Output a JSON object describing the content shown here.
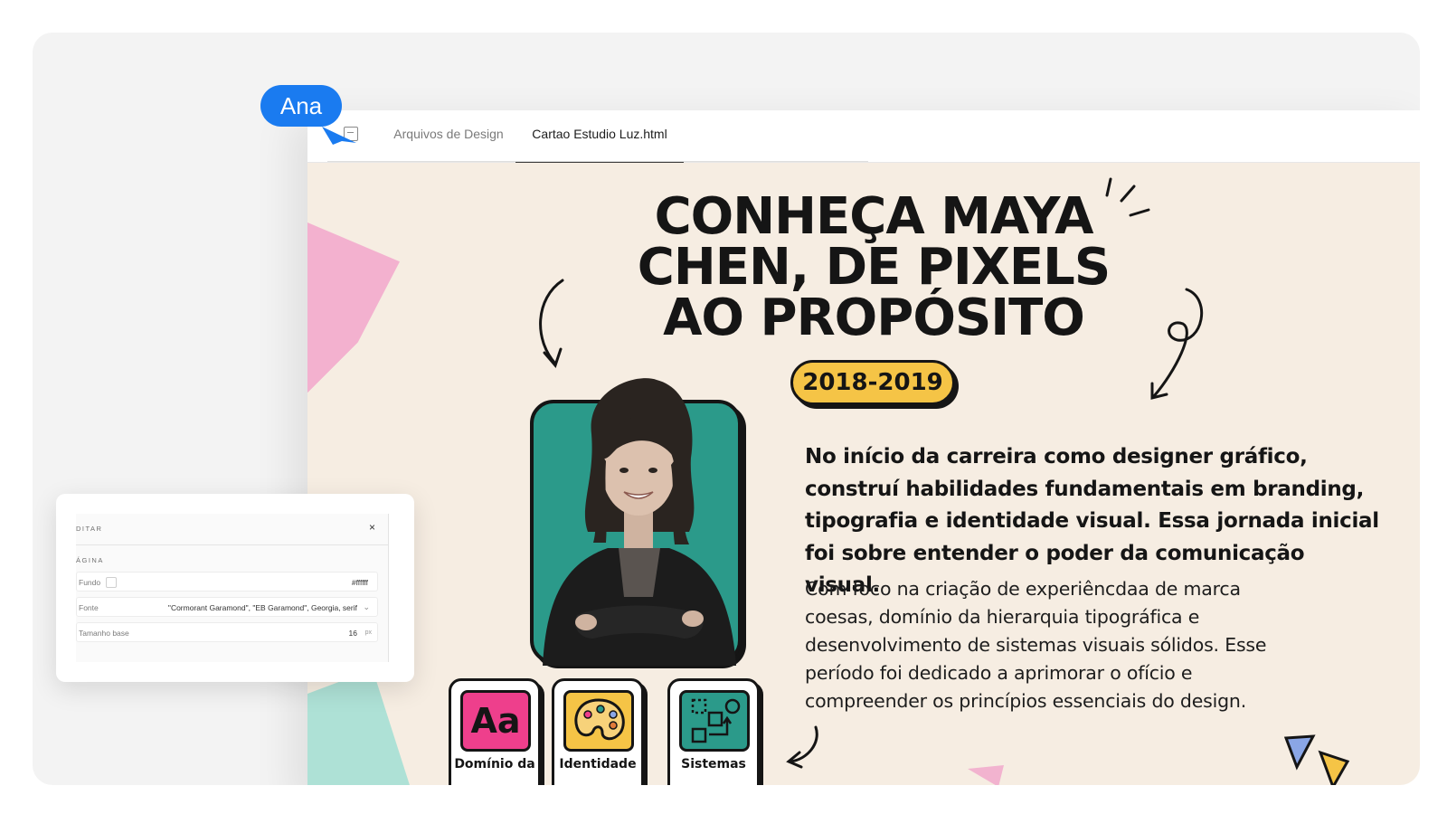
{
  "collaborator": {
    "name": "Ana"
  },
  "tabs": [
    {
      "label": "Arquivos de Design",
      "active": false
    },
    {
      "label": "Cartao Estudio Luz.html",
      "active": true
    }
  ],
  "page": {
    "headline_lines": [
      "CONHEÇA MAYA",
      "CHEN, DE PIXELS",
      "AO PROPÓSITO"
    ],
    "year": "2018-2019",
    "lead": "No início da carreira como designer gráfico, construí habilidades fundamentais em branding, tipografia e identidade visual. Essa jornada inicial foi sobre entender o poder da comunicação visual.",
    "body": "Com foco na criação de experiêncdaa de marca coesas, domínio da hierarquia tipográfica e desenvolvimento de sistemas visuais sólidos. Esse período foi dedicado a aprimorar o ofício e compreender os princípios essenciais do design.",
    "skills": [
      {
        "icon": "typography-icon",
        "glyph": "Aa",
        "label": "Domínio da"
      },
      {
        "icon": "palette-icon",
        "label": "Identidade"
      },
      {
        "icon": "systems-icon",
        "label": "Sistemas"
      }
    ]
  },
  "editor": {
    "title": "DITAR",
    "close": "×",
    "section": "ÁGINA",
    "fields": [
      {
        "label": "Fundo",
        "value": "#ffffff"
      },
      {
        "label": "Fonte",
        "value": "\"Cormorant Garamond\", \"EB Garamond\", Georgia, serif"
      },
      {
        "label": "Tamanho base",
        "value": "16",
        "unit": "px"
      }
    ]
  },
  "colors": {
    "accent_blue": "#1a7bf0",
    "canvas_bg": "#f6ede2",
    "badge_yellow": "#f5c446",
    "portrait_teal": "#2b9a8a",
    "typography_pink": "#ee3f8c"
  }
}
